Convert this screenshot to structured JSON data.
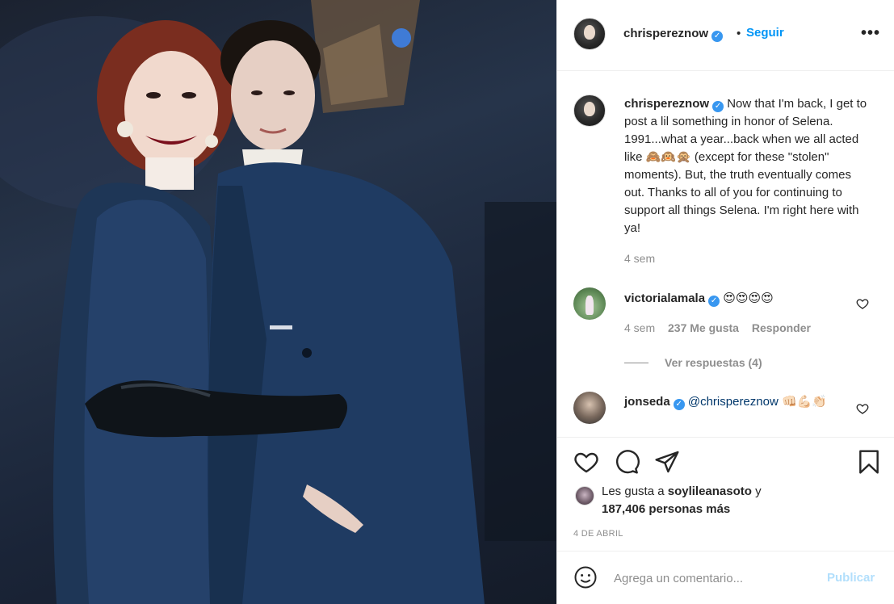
{
  "post": {
    "owner_username": "chrispereznow",
    "follow_label": "Seguir",
    "separator": "•",
    "more_label": "•••"
  },
  "caption": {
    "username": "chrispereznow",
    "text": "Now that I'm back, I get to post a lil something in honor of Selena. 1991...what a year...back when we all acted like 🙈🙉🙊 (except for these \"stolen\" moments). But, the truth eventually comes out. Thanks to all of you for continuing to support all things Selena. I'm right here with ya!",
    "time": "4 sem"
  },
  "comments": [
    {
      "username": "victorialamala",
      "text": "😍😍😍😍",
      "time": "4 sem",
      "likes": "237 Me gusta",
      "reply_label": "Responder",
      "view_replies": "Ver respuestas (4)"
    },
    {
      "username": "jonseda",
      "mention": "@chrispereznow",
      "text": "👊🏻💪🏻👏🏻"
    }
  ],
  "likes": {
    "prefix": "Les gusta a",
    "liker": "soylileanasoto",
    "conj": "y",
    "count_text": "187,406 personas más"
  },
  "date": "4 DE ABRIL",
  "composer": {
    "placeholder": "Agrega un comentario...",
    "publish_label": "Publicar"
  },
  "icons": {
    "like": "heart-icon",
    "comment": "comment-icon",
    "share": "paper-plane-icon",
    "save": "bookmark-icon",
    "emoji": "smiley-icon",
    "verified": "verified-badge-icon",
    "more": "more-options-icon"
  },
  "colors": {
    "accent": "#0095f6",
    "verified": "#3897f0",
    "muted": "#8e8e8e",
    "text": "#262626",
    "publish_disabled": "#b2dffc"
  }
}
